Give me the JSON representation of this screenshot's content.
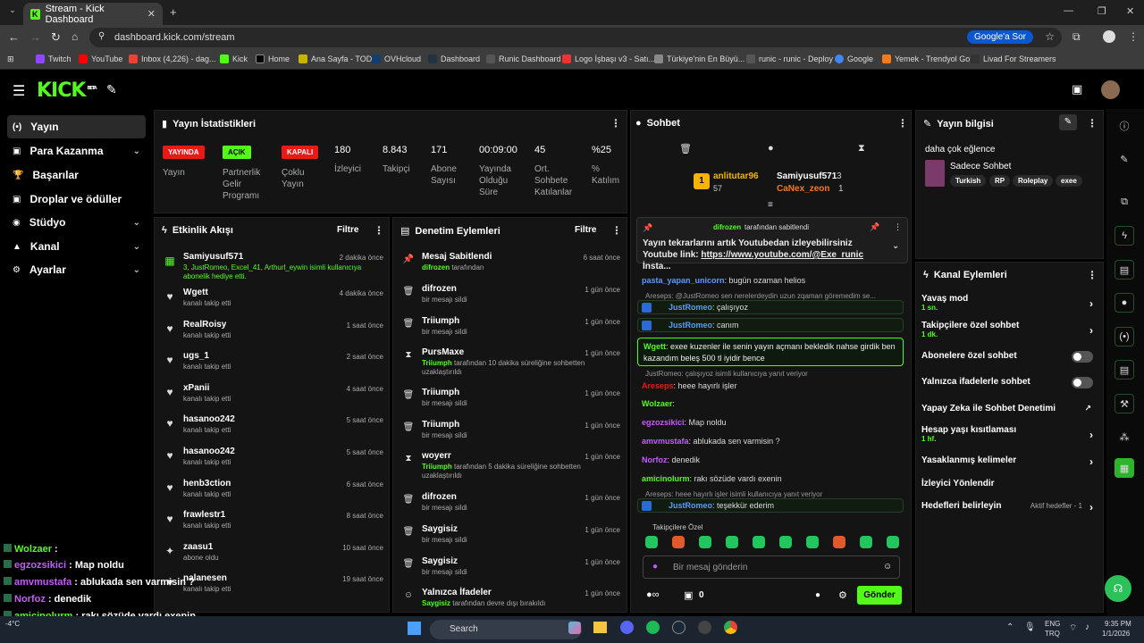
{
  "browser": {
    "tab_title": "Stream - Kick Dashboard",
    "url": "dashboard.kick.com/stream",
    "ask_google": "Google'a Sor",
    "bookmarks": [
      "Twitch",
      "YouTube",
      "Inbox (4,226) - dag...",
      "Kick",
      "Home",
      "Ana Sayfa - TOD",
      "OVHcloud",
      "Dashboard",
      "Runic Dashboard",
      "Logo İşbaşı v3 - Satı...",
      "Türkiye'nin En Büyü...",
      "runic - runic - Deploy",
      "Google",
      "Yemek - Trendyol Go",
      "Livad For Streamers"
    ]
  },
  "header": {
    "logo": "KICK",
    "beta": "BETA"
  },
  "nav": [
    {
      "label": "Yayın",
      "icon": "(•)"
    },
    {
      "label": "Para Kazanma",
      "icon": "▣",
      "chevron": true
    },
    {
      "label": "Başarılar",
      "icon": "🏆"
    },
    {
      "label": "Droplar ve ödüller",
      "icon": "▣"
    },
    {
      "label": "Stüdyo",
      "icon": "◉",
      "chevron": true
    },
    {
      "label": "Kanal",
      "icon": "▲",
      "chevron": true
    },
    {
      "label": "Ayarlar",
      "icon": "⚙",
      "chevron": true
    }
  ],
  "stats": {
    "title": "Yayın İstatistikleri",
    "badges": [
      {
        "text": "YAYINDA",
        "label": "Yayın",
        "color": "#e91916",
        "fg": "#fff"
      },
      {
        "text": "AÇIK",
        "label": "Partnerlik Gelir Programı",
        "color": "#53fc18",
        "fg": "#000"
      },
      {
        "text": "KAPALI",
        "label": "Çoklu Yayın",
        "color": "#e91916",
        "fg": "#fff"
      }
    ],
    "items": [
      {
        "value": "180",
        "label": "İzleyici"
      },
      {
        "value": "8.843",
        "label": "Takipçi"
      },
      {
        "value": "171",
        "label": "Abone Sayısı"
      },
      {
        "value": "00:09:00",
        "label": "Yayında Olduğu Süre"
      },
      {
        "value": "45",
        "label": "Ort. Sohbete Katılanlar"
      },
      {
        "value": "%25",
        "label": "% Katılım"
      }
    ]
  },
  "activity": {
    "title": "Etkinlik Akışı",
    "filter": "Filtre",
    "items": [
      {
        "icon": "▦",
        "name": "Samiyusuf571",
        "time": "2 dakika önce",
        "sub": "3, JustRomeo, Excel_41, Arthurl_eywin isimli kullanıcıya abonelik hediye etti.",
        "green": true
      },
      {
        "icon": "♥",
        "name": "Wgett",
        "time": "4 dakika önce",
        "sub": "kanalı takip etti"
      },
      {
        "icon": "♥",
        "name": "RealRoisy",
        "time": "1 saat önce",
        "sub": "kanalı takip etti"
      },
      {
        "icon": "♥",
        "name": "ugs_1",
        "time": "2 saat önce",
        "sub": "kanalı takip etti"
      },
      {
        "icon": "♥",
        "name": "xPanii",
        "time": "4 saat önce",
        "sub": "kanalı takip etti"
      },
      {
        "icon": "♥",
        "name": "hasanoo242",
        "time": "5 saat önce",
        "sub": "kanalı takip etti"
      },
      {
        "icon": "♥",
        "name": "hasanoo242",
        "time": "5 saat önce",
        "sub": "kanalı takip etti"
      },
      {
        "icon": "♥",
        "name": "henb3ction",
        "time": "6 saat önce",
        "sub": "kanalı takip etti"
      },
      {
        "icon": "♥",
        "name": "frawlestr1",
        "time": "8 saat önce",
        "sub": "kanalı takip etti"
      },
      {
        "icon": "✦",
        "name": "zaasu1",
        "time": "10 saat önce",
        "sub": "abone oldu"
      },
      {
        "icon": "♥",
        "name": "nalanesen",
        "time": "19 saat önce",
        "sub": "kanalı takip etti"
      }
    ]
  },
  "moderation": {
    "title": "Denetim Eylemleri",
    "filter": "Filtre",
    "items": [
      {
        "icon": "📌",
        "name": "Mesaj Sabitlendi",
        "time": "6 saat önce",
        "sub1": "difrozen",
        "sub2": " tarafından"
      },
      {
        "icon": "🗑",
        "name": "difrozen",
        "time": "1 gün önce",
        "sub1": "",
        "sub2": "bir mesajı sildi"
      },
      {
        "icon": "🗑",
        "name": "Triiumph",
        "time": "1 gün önce",
        "sub1": "",
        "sub2": "bir mesajı sildi"
      },
      {
        "icon": "⧗",
        "name": "PursMaxe",
        "time": "1 gün önce",
        "sub1": "Triiumph",
        "sub2": " tarafından 10 dakika süreliğine sohbetten uzaklaştırıldı"
      },
      {
        "icon": "🗑",
        "name": "Triiumph",
        "time": "1 gün önce",
        "sub1": "",
        "sub2": "bir mesajı sildi"
      },
      {
        "icon": "🗑",
        "name": "Triiumph",
        "time": "1 gün önce",
        "sub1": "",
        "sub2": "bir mesajı sildi"
      },
      {
        "icon": "⧗",
        "name": "woyerr",
        "time": "1 gün önce",
        "sub1": "Triiumph",
        "sub2": " tarafından 5 dakika süreliğine sohbetten uzaklaştırıldı"
      },
      {
        "icon": "🗑",
        "name": "difrozen",
        "time": "1 gün önce",
        "sub1": "",
        "sub2": "bir mesajı sildi"
      },
      {
        "icon": "🗑",
        "name": "Saygisiz",
        "time": "1 gün önce",
        "sub1": "",
        "sub2": "bir mesajı sildi"
      },
      {
        "icon": "🗑",
        "name": "Saygisiz",
        "time": "1 gün önce",
        "sub1": "",
        "sub2": "bir mesajı sildi"
      },
      {
        "icon": "☺",
        "name": "Yalnızca İfadeler",
        "time": "1 gün önce",
        "sub1": "Saygisiz",
        "sub2": " tarafından devre dışı bırakıldı"
      }
    ]
  },
  "chat": {
    "title": "Sohbet",
    "top": {
      "first": "anlitutar96",
      "first_count": "57",
      "second": "Samiyusuf571",
      "second_count": "3",
      "third": "CaNex_zeon",
      "third_count": "1"
    },
    "pinned": {
      "by": "difrozen",
      "by_suffix": "tarafından sabitlendi",
      "text": "Yayın tekrarlarını artık Youtubedan izleyebilirsiniz Youtube link: ",
      "link": "https://www.youtube.com/@Exe_runic",
      "tail": " İnsta..."
    },
    "messages": [
      {
        "user": "pasta_yapan_unicorn",
        "text": ": bugün ozaman helios",
        "color": "#5b9bff"
      },
      {
        "reply": "Areseps: @JustRomeo sen nerelerdeydin uzun zqaman göremedim se..."
      },
      {
        "user": "JustRomeo",
        "text": ": çalışıyoz",
        "color": "#5b9bff",
        "boxed": true
      },
      {
        "user": "JustRomeo",
        "text": ": canım",
        "color": "#5b9bff",
        "boxed": true
      },
      {
        "user": "Wgett",
        "text": ": exee kuzenler ile senin yayın açmanı bekledik nahse girdik ben kazandım beleş 500 tl iyidir bence",
        "color": "#53fc18",
        "highlight": true
      },
      {
        "reply": "JustRomeo: çalışıyoz isimli kullanıcıya yanıt veriyor"
      },
      {
        "user": "Areseps",
        "text": ": heee hayırlı işler",
        "color": "#e91916"
      },
      {
        "user": "Wolzaer",
        "text": ":",
        "color": "#53fc18"
      },
      {
        "user": "egzozsikici",
        "text": ": Map noldu",
        "color": "#c45bff"
      },
      {
        "user": "amvmustafa",
        "text": ": ablukada sen varmisin ?",
        "color": "#c45bff"
      },
      {
        "user": "Norfoz",
        "text": ": denedik",
        "color": "#c45bff"
      },
      {
        "user": "amicinolurm",
        "text": ": rakı sözüde vardı exenin",
        "color": "#53fc18"
      },
      {
        "reply": "Areseps: heee hayırlı işler isimli kullanıcıya yanıt veriyor"
      },
      {
        "user": "JustRomeo",
        "text": ": teşekkür ederim",
        "color": "#5b9bff",
        "boxed": true
      }
    ],
    "emote_label": "Takipçilere Özel",
    "input_placeholder": "Bir mesaj gönderin",
    "points": "0",
    "send": "Gönder"
  },
  "streaminfo": {
    "title": "Yayın bilgisi",
    "stream_title": "daha çok eğlence",
    "category": "Sadece Sohbet",
    "tags": [
      "Turkish",
      "RP",
      "Roleplay",
      "exee"
    ]
  },
  "channel_actions": {
    "title": "Kanal Eylemleri",
    "items": [
      {
        "label": "Yavaş mod",
        "sub": "1 sn.",
        "type": "arrow"
      },
      {
        "label": "Takipçilere özel sohbet",
        "sub": "1 dk.",
        "type": "arrow"
      },
      {
        "label": "Abonelere özel sohbet",
        "type": "toggle"
      },
      {
        "label": "Yalnızca ifadelerle sohbet",
        "type": "toggle"
      },
      {
        "label": "Yapay Zeka ile Sohbet Denetimi",
        "type": "ext"
      },
      {
        "label": "Hesap yaşı kısıtlaması",
        "sub": "1 hf.",
        "type": "arrow"
      },
      {
        "label": "Yasaklanmış kelimeler",
        "type": "arrow"
      },
      {
        "label": "İzleyici Yönlendir",
        "type": "none"
      },
      {
        "label": "Hedefleri belirleyin",
        "type": "arrow",
        "extra": "Aktif hedefler - 1"
      }
    ]
  },
  "overlay": [
    {
      "user": "Wolzaer",
      "text": " :",
      "color": "#53fc18"
    },
    {
      "user": "egzozsikici",
      "text": " : Map noldu",
      "color": "#c45bff"
    },
    {
      "user": "amvmustafa",
      "text": " : ablukada sen varmisin ?",
      "color": "#c45bff"
    },
    {
      "user": "Norfoz",
      "text": " : denedik",
      "color": "#c45bff"
    },
    {
      "user": "amicinolurm",
      "text": " : rakı sözüde vardı exenin",
      "color": "#53fc18"
    },
    {
      "user": "JustRomeo",
      "text": " : teşekkür ederim",
      "color": "#5b9bff"
    }
  ],
  "taskbar": {
    "weather": "-4°C",
    "search": "Search",
    "lang1": "ENG",
    "lang2": "TRQ",
    "time": "9:35 PM",
    "date": "1/1/2026"
  }
}
